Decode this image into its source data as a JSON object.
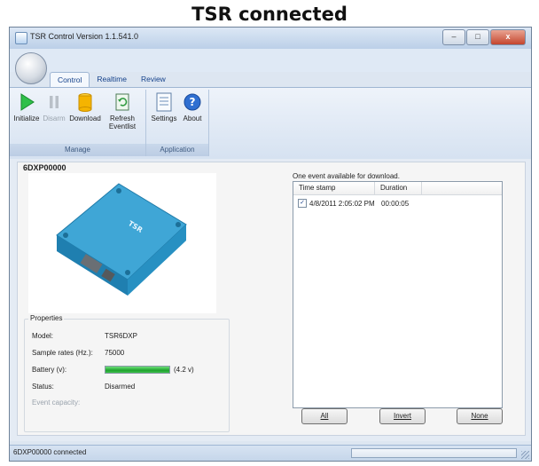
{
  "caption": "TSR connected",
  "window": {
    "title": "TSR Control Version 1.1.541.0",
    "controls": {
      "minimize": "–",
      "maximize": "□",
      "close": "x"
    }
  },
  "ribbon": {
    "tabs": [
      {
        "label": "Control",
        "active": true
      },
      {
        "label": "Realtime",
        "active": false
      },
      {
        "label": "Review",
        "active": false
      }
    ],
    "groups": {
      "manage": {
        "label": "Manage",
        "buttons": [
          {
            "label": "Initialize",
            "icon": "play-icon",
            "enabled": true
          },
          {
            "label": "Disarm",
            "icon": "pause-icon",
            "enabled": false
          },
          {
            "label": "Download",
            "icon": "download-icon",
            "enabled": true
          },
          {
            "label": "Refresh Eventlist",
            "icon": "refresh-icon",
            "enabled": true
          }
        ]
      },
      "application": {
        "label": "Application",
        "buttons": [
          {
            "label": "Settings",
            "icon": "settings-icon",
            "enabled": true
          },
          {
            "label": "About",
            "icon": "help-icon",
            "enabled": true
          }
        ]
      }
    }
  },
  "device": {
    "id": "6DXP00000",
    "properties_title": "Properties",
    "properties": {
      "model_label": "Model:",
      "model_value": "TSR6DXP",
      "rate_label": "Sample rates (Hz.):",
      "rate_value": "75000",
      "battery_label": "Battery (v):",
      "battery_value": "(4.2 v)",
      "battery_fill": 1.0,
      "status_label": "Status:",
      "status_value": "Disarmed",
      "capacity_label": "Event capacity:"
    }
  },
  "events": {
    "caption": "One event available for download.",
    "columns": [
      "Time stamp",
      "Duration"
    ],
    "rows": [
      {
        "checked": true,
        "timestamp": "4/8/2011 2:05:02 PM",
        "duration": "00:00:05"
      }
    ],
    "buttons": {
      "all": "All",
      "invert": "Invert",
      "none": "None"
    }
  },
  "statusbar": {
    "text": "6DXP00000 connected"
  },
  "colors": {
    "accent": "#15428b",
    "battery": "#1ea32e",
    "ribbon": "#dde6f1"
  }
}
